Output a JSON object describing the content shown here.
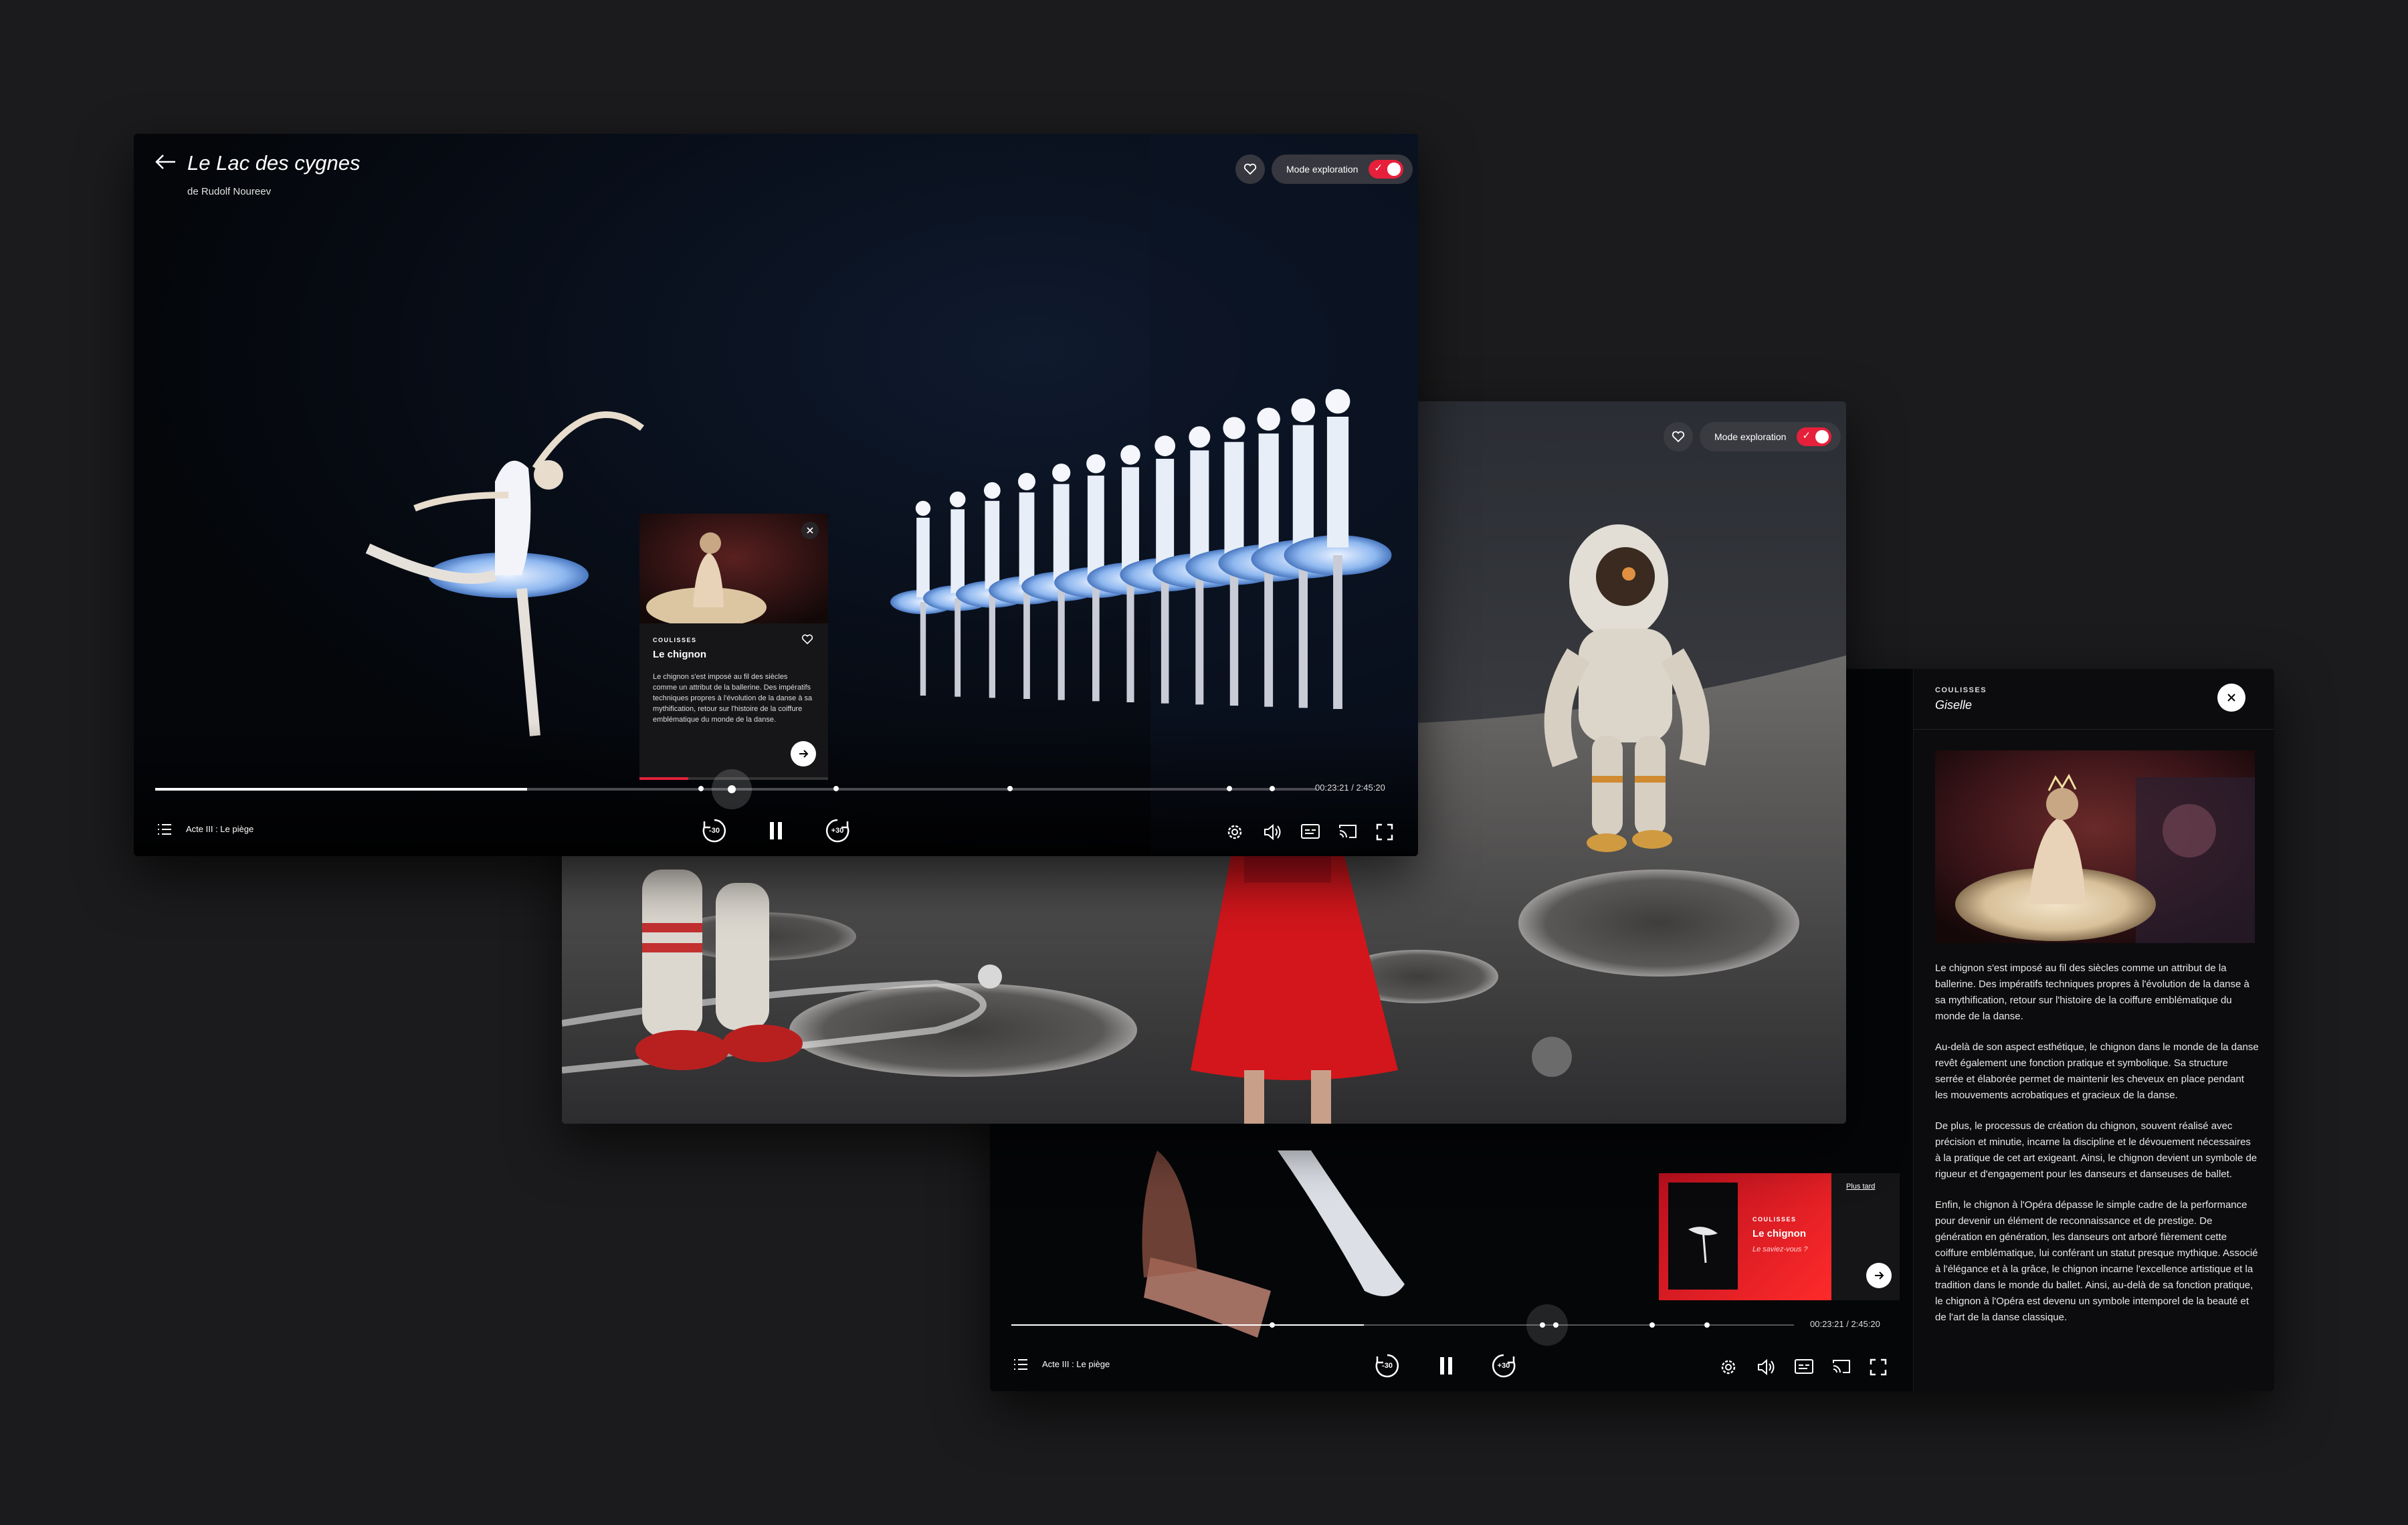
{
  "colors": {
    "accent": "#e6203a",
    "background": "#1b1b1d",
    "player_bg": "#050608"
  },
  "player1": {
    "title": "Le Lac des cygnes",
    "subtitle": "de Rudolf Noureev",
    "mode_label": "Mode exploration",
    "card": {
      "kicker": "COULISSES",
      "title": "Le chignon",
      "text": "Le chignon s'est imposé au fil des siècles comme un attribut de la ballerine. Des impératifs techniques propres à l'évolution de la danse à sa mythification, retour sur l'histoire de la coiffure emblématique du monde de la danse."
    },
    "time": "00:23:21 / 2:45:20",
    "chapter": "Acte III : Le piège",
    "rewind_label": "-30",
    "forward_label": "+30",
    "progress": 0.32
  },
  "player2": {
    "mode_label": "Mode exploration"
  },
  "player3": {
    "time": "00:23:21 / 2:45:20",
    "chapter": "Acte III : Le piège",
    "rewind_label": "-30",
    "forward_label": "+30",
    "progress": 0.45,
    "promo": {
      "later": "Plus tard",
      "kicker": "COULISSES",
      "title": "Le chignon",
      "tagline": "Le saviez-vous ?"
    }
  },
  "sidepanel": {
    "kicker": "COULISSES",
    "title": "Giselle",
    "paragraphs": [
      "Le chignon s'est imposé au fil des siècles comme un attribut de la ballerine. Des impératifs techniques propres à l'évolution de la danse à sa mythification, retour sur l'histoire de la coiffure emblématique du monde de la danse.",
      "Au-delà de son aspect esthétique, le chignon dans le monde de la danse revêt également une fonction pratique et symbolique. Sa structure serrée et élaborée permet de maintenir les cheveux en place pendant les mouvements acrobatiques et gracieux de la danse.",
      "De plus, le processus de création du chignon, souvent réalisé avec précision et minutie, incarne la discipline et le dévouement nécessaires à la pratique de cet art exigeant. Ainsi, le chignon devient un symbole de rigueur et d'engagement pour les danseurs et danseuses de ballet.",
      "Enfin, le chignon à l'Opéra dépasse le simple cadre de la performance pour devenir un élément de reconnaissance et de prestige. De génération en génération, les danseurs ont arboré fièrement cette coiffure emblématique, lui conférant un statut presque mythique. Associé à l'élégance et à la grâce, le chignon incarne l'excellence artistique et la tradition dans le monde du ballet. Ainsi, au-delà de sa fonction pratique, le chignon à l'Opéra est devenu un symbole intemporel de la beauté et de l'art de la danse classique."
    ]
  },
  "icons": [
    "back-arrow-icon",
    "heart-icon",
    "close-icon",
    "arrow-right-icon",
    "chapters-list-icon",
    "rewind-30-icon",
    "pause-icon",
    "forward-30-icon",
    "settings-icon",
    "volume-icon",
    "subtitles-icon",
    "cast-icon",
    "fullscreen-icon"
  ]
}
